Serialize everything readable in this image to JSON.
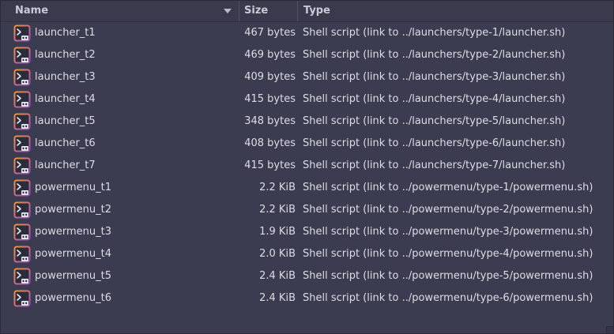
{
  "header": {
    "name_label": "Name",
    "size_label": "Size",
    "type_label": "Type"
  },
  "colors": {
    "background": "#3b3c4f",
    "text": "#dcdde6",
    "icon_accent_orange": "#f4923a",
    "icon_accent_purple": "#9b4dca"
  },
  "files": [
    {
      "name": "launcher_t1",
      "size": "467 bytes",
      "type": "Shell script (link to ../launchers/type-1/launcher.sh)",
      "icon": "shell-script-icon"
    },
    {
      "name": "launcher_t2",
      "size": "469 bytes",
      "type": "Shell script (link to ../launchers/type-2/launcher.sh)",
      "icon": "shell-script-icon"
    },
    {
      "name": "launcher_t3",
      "size": "409 bytes",
      "type": "Shell script (link to ../launchers/type-3/launcher.sh)",
      "icon": "shell-script-icon"
    },
    {
      "name": "launcher_t4",
      "size": "415 bytes",
      "type": "Shell script (link to ../launchers/type-4/launcher.sh)",
      "icon": "shell-script-icon"
    },
    {
      "name": "launcher_t5",
      "size": "348 bytes",
      "type": "Shell script (link to ../launchers/type-5/launcher.sh)",
      "icon": "shell-script-icon"
    },
    {
      "name": "launcher_t6",
      "size": "408 bytes",
      "type": "Shell script (link to ../launchers/type-6/launcher.sh)",
      "icon": "shell-script-icon"
    },
    {
      "name": "launcher_t7",
      "size": "415 bytes",
      "type": "Shell script (link to ../launchers/type-7/launcher.sh)",
      "icon": "shell-script-icon"
    },
    {
      "name": "powermenu_t1",
      "size": "2.2 KiB",
      "type": "Shell script (link to ../powermenu/type-1/powermenu.sh)",
      "icon": "shell-script-icon"
    },
    {
      "name": "powermenu_t2",
      "size": "2.2 KiB",
      "type": "Shell script (link to ../powermenu/type-2/powermenu.sh)",
      "icon": "shell-script-icon"
    },
    {
      "name": "powermenu_t3",
      "size": "1.9 KiB",
      "type": "Shell script (link to ../powermenu/type-3/powermenu.sh)",
      "icon": "shell-script-icon"
    },
    {
      "name": "powermenu_t4",
      "size": "2.0 KiB",
      "type": "Shell script (link to ../powermenu/type-4/powermenu.sh)",
      "icon": "shell-script-icon"
    },
    {
      "name": "powermenu_t5",
      "size": "2.4 KiB",
      "type": "Shell script (link to ../powermenu/type-5/powermenu.sh)",
      "icon": "shell-script-icon"
    },
    {
      "name": "powermenu_t6",
      "size": "2.4 KiB",
      "type": "Shell script (link to ../powermenu/type-6/powermenu.sh)",
      "icon": "shell-script-icon"
    }
  ]
}
